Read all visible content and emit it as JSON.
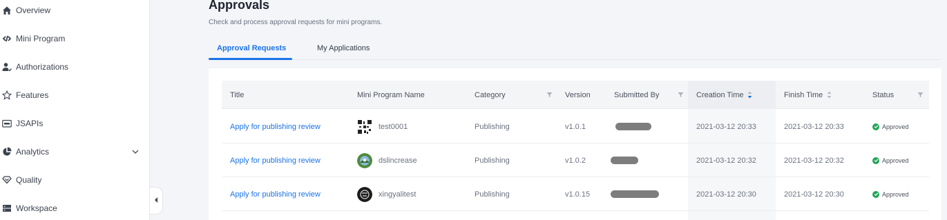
{
  "sidebar": {
    "items": [
      {
        "label": "Overview",
        "icon": "home-icon"
      },
      {
        "label": "Mini Program",
        "icon": "link-icon"
      },
      {
        "label": "Authorizations",
        "icon": "user-check-icon"
      },
      {
        "label": "Features",
        "icon": "star-icon"
      },
      {
        "label": "JSAPIs",
        "icon": "api-icon"
      },
      {
        "label": "Analytics",
        "icon": "pie-chart-icon",
        "expandable": true
      },
      {
        "label": "Quality",
        "icon": "shield-icon"
      },
      {
        "label": "Workspace",
        "icon": "server-icon"
      }
    ]
  },
  "header": {
    "title": "Approvals",
    "subtitle": "Check and process approval requests for mini programs."
  },
  "tabs": [
    {
      "label": "Approval Requests",
      "active": true
    },
    {
      "label": "My Applications",
      "active": false
    }
  ],
  "table": {
    "columns": [
      "Title",
      "Mini Program Name",
      "Category",
      "Version",
      "Submitted By",
      "Creation Time",
      "Finish Time",
      "Status"
    ],
    "rows": [
      {
        "title": "Apply for publishing review",
        "program": "test0001",
        "category": "Publishing",
        "version": "v1.0.1",
        "creation": "2021-03-12 20:33",
        "finish": "2021-03-12 20:33",
        "status": "Approved"
      },
      {
        "title": "Apply for publishing review",
        "program": "dslincrease",
        "category": "Publishing",
        "version": "v1.0.2",
        "creation": "2021-03-12 20:32",
        "finish": "2021-03-12 20:32",
        "status": "Approved"
      },
      {
        "title": "Apply for publishing review",
        "program": "xingyalitest",
        "category": "Publishing",
        "version": "v1.0.15",
        "creation": "2021-03-12 20:30",
        "finish": "2021-03-12 20:30",
        "status": "Approved"
      }
    ]
  },
  "colors": {
    "accent": "#1a73e8",
    "approved": "#23a55a"
  }
}
